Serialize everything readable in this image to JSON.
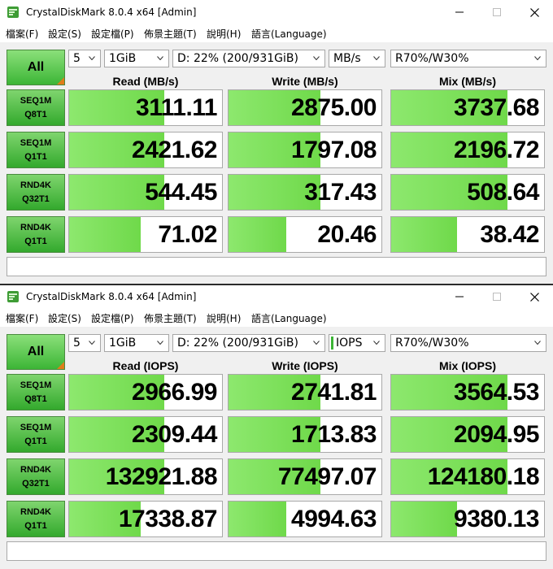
{
  "colors": {
    "bar_green": "#7ee05a",
    "label_green": "#5cc04c",
    "accent_orange": "#e07d1a"
  },
  "windows": [
    {
      "title": "CrystalDiskMark 8.0.4 x64 [Admin]",
      "menu": [
        "檔案(F)",
        "設定(S)",
        "設定檔(P)",
        "佈景主題(T)",
        "說明(H)",
        "語言(Language)"
      ],
      "all_label": "All",
      "count": "5",
      "size": "1GiB",
      "drive": "D: 22% (200/931GiB)",
      "unit": "MB/s",
      "mix": "R70%/W30%",
      "headers": [
        "Read (MB/s)",
        "Write (MB/s)",
        "Mix (MB/s)"
      ],
      "rows": [
        {
          "l1": "SEQ1M",
          "l2": "Q8T1",
          "read": "3111.11",
          "write": "2875.00",
          "mix": "3737.68",
          "fills": [
            0.62,
            0.6,
            0.76
          ]
        },
        {
          "l1": "SEQ1M",
          "l2": "Q1T1",
          "read": "2421.62",
          "write": "1797.08",
          "mix": "2196.72",
          "fills": [
            0.62,
            0.6,
            0.76
          ]
        },
        {
          "l1": "RND4K",
          "l2": "Q32T1",
          "read": "544.45",
          "write": "317.43",
          "mix": "508.64",
          "fills": [
            0.62,
            0.6,
            0.76
          ]
        },
        {
          "l1": "RND4K",
          "l2": "Q1T1",
          "read": "71.02",
          "write": "20.46",
          "mix": "38.42",
          "fills": [
            0.47,
            0.38,
            0.43
          ]
        }
      ],
      "status": ""
    },
    {
      "title": "CrystalDiskMark 8.0.4 x64 [Admin]",
      "menu": [
        "檔案(F)",
        "設定(S)",
        "設定檔(P)",
        "佈景主題(T)",
        "說明(H)",
        "語言(Language)"
      ],
      "all_label": "All",
      "count": "5",
      "size": "1GiB",
      "drive": "D: 22% (200/931GiB)",
      "unit": "IOPS",
      "mix": "R70%/W30%",
      "headers": [
        "Read (IOPS)",
        "Write (IOPS)",
        "Mix (IOPS)"
      ],
      "rows": [
        {
          "l1": "SEQ1M",
          "l2": "Q8T1",
          "read": "2966.99",
          "write": "2741.81",
          "mix": "3564.53",
          "fills": [
            0.62,
            0.6,
            0.76
          ]
        },
        {
          "l1": "SEQ1M",
          "l2": "Q1T1",
          "read": "2309.44",
          "write": "1713.83",
          "mix": "2094.95",
          "fills": [
            0.62,
            0.6,
            0.76
          ]
        },
        {
          "l1": "RND4K",
          "l2": "Q32T1",
          "read": "132921.88",
          "write": "77497.07",
          "mix": "124180.18",
          "fills": [
            0.62,
            0.6,
            0.76
          ]
        },
        {
          "l1": "RND4K",
          "l2": "Q1T1",
          "read": "17338.87",
          "write": "4994.63",
          "mix": "9380.13",
          "fills": [
            0.47,
            0.38,
            0.43
          ]
        }
      ],
      "status": ""
    }
  ]
}
